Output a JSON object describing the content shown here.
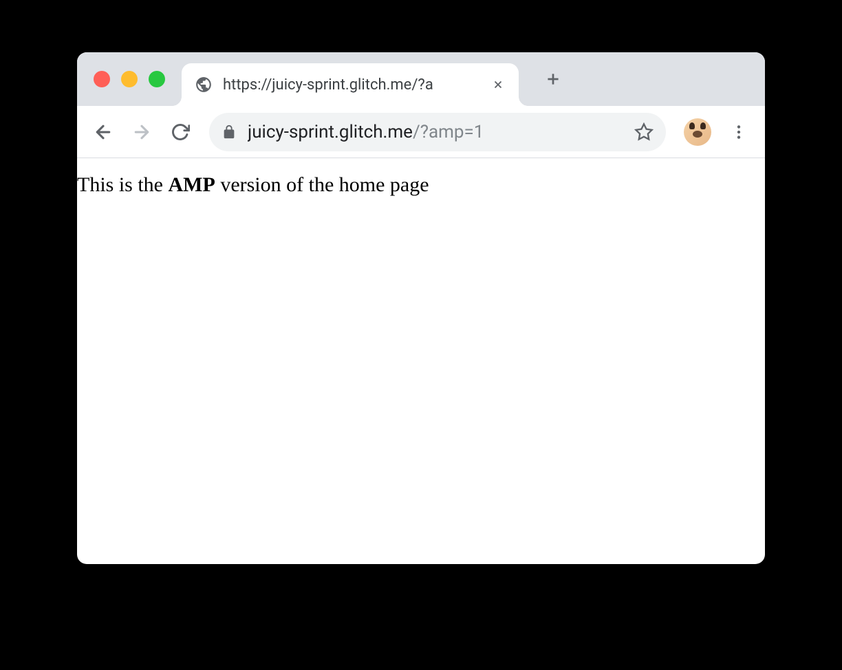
{
  "tab": {
    "title": "https://juicy-sprint.glitch.me/?a"
  },
  "addressBar": {
    "domain": "juicy-sprint.glitch.me",
    "query": "/?amp=1"
  },
  "page": {
    "text_before": "This is the ",
    "text_bold": "AMP",
    "text_after": " version of the home page"
  }
}
